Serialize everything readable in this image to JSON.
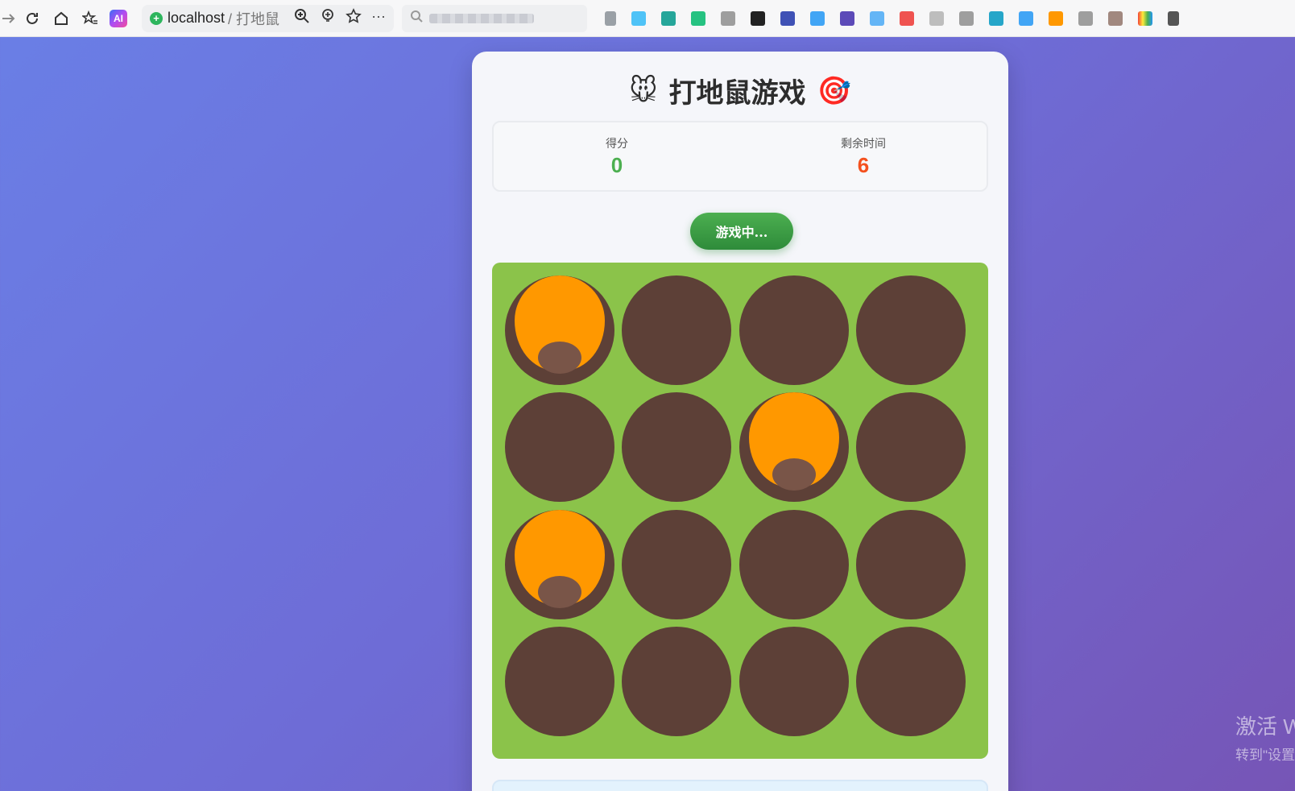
{
  "browser": {
    "url_host": "localhost",
    "url_path": "/ 打地鼠",
    "ai_label": "AI"
  },
  "game": {
    "title": "打地鼠游戏",
    "title_icon_left": "🐭",
    "title_icon_right": "🎯",
    "score_label": "得分",
    "score_value": "0",
    "time_label": "剩余时间",
    "time_value": "6",
    "status_button": "游戏中...",
    "grid_rows": 4,
    "grid_cols": 4,
    "moles_visible": [
      0,
      6,
      8
    ]
  },
  "colors": {
    "board": "#8bc34a",
    "hole": "#5d4037",
    "mole": "#ff9800",
    "score": "#4caf50",
    "time": "#f4511e"
  },
  "watermark": {
    "line1": "激活 W",
    "line2": "转到\"设置"
  }
}
